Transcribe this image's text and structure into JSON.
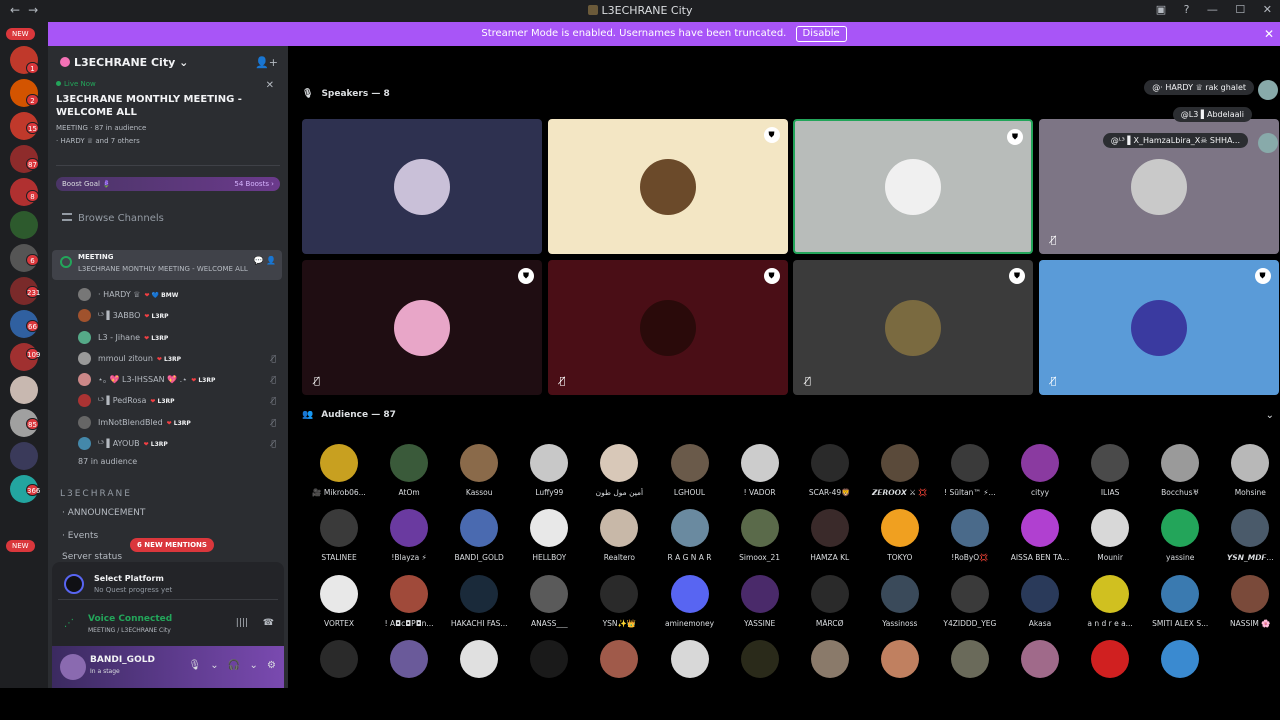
{
  "window": {
    "title": "L3ECHRANE City",
    "nav_back": "←",
    "nav_fwd": "→",
    "controls": "▣ ? — ☐ ✕"
  },
  "banner": {
    "text": "Streamer Mode is enabled. Usernames have been truncated.",
    "button": "Disable",
    "close": "✕"
  },
  "guilds": {
    "new_top": "NEW",
    "new_bottom": "NEW",
    "badges": [
      "1",
      "2",
      "15",
      "87",
      "8",
      "6",
      "231",
      "66",
      "109",
      "85",
      "366"
    ]
  },
  "server": {
    "name": "L3ECHRANE City",
    "chevron": "⌄",
    "invite_icon": "👤+"
  },
  "live": {
    "label": "Live Now",
    "title": "L3ECHRANE MONTHLY MEETING - WELCOME ALL",
    "meta_label": "MEETING",
    "audience": "87 in audience",
    "host": "· HARDY ♕ and 7 others",
    "close": "✕"
  },
  "boost": {
    "label": "Boost Goal 🪻",
    "count": "54 Boosts ›"
  },
  "browse": "Browse Channels",
  "meeting": {
    "name": "MEETING",
    "sub": "L3ECHRANE MONTHLY MEETING - WELCOME ALL",
    "icons": "💬 👤"
  },
  "members": [
    {
      "name": "· HARDY ♕",
      "tag": "💙 BMW",
      "color": "#777",
      "muted": false
    },
    {
      "name": "ᴸ³ ▌3ABBO",
      "tag": "L3RP",
      "color": "#a0522d",
      "muted": false
    },
    {
      "name": "L3 - Jihane",
      "tag": "L3RP",
      "color": "#5a8",
      "muted": false
    },
    {
      "name": "mmoul zitoun",
      "tag": "L3RP",
      "color": "#999",
      "muted": true
    },
    {
      "name": "⋆｡ 💖 L3-IHSSAN 💖 .⋆",
      "tag": "L3RP",
      "color": "#c88",
      "muted": true
    },
    {
      "name": "ᴸ³ ▌PedRosa",
      "tag": "L3RP",
      "color": "#a33",
      "muted": true
    },
    {
      "name": "ImNotBlendBled",
      "tag": "L3RP",
      "color": "#666",
      "muted": true
    },
    {
      "name": "ᴸ³ ▌AYOUB",
      "tag": "L3RP",
      "color": "#48a",
      "muted": true
    }
  ],
  "member_tag_heart": "❤",
  "audience_line": "87 in audience",
  "category": "L3ECHRANE",
  "channels": [
    {
      "name": "· ANNOUNCEMENT"
    },
    {
      "name": "· Events"
    },
    {
      "name": "Server status"
    }
  ],
  "mentions": "6 NEW MENTIONS",
  "quest": {
    "title": "Select Platform",
    "sub": "No Quest progress yet"
  },
  "voice": {
    "status": "Voice Connected",
    "channel": "MEETING / L3ECHRANE City",
    "icons": "|||| ☎"
  },
  "user": {
    "name": "BANDI_GOLD",
    "status": "In a stage",
    "controls": "🎙 ⌄ 🎧 ⌄ ⚙"
  },
  "speakers": {
    "label": "Speakers — 8",
    "icon": "🎙"
  },
  "speaker_tiles": [
    {
      "bg": "#2e3150",
      "av": "#c9c0d8",
      "mod": false,
      "mic_off": false
    },
    {
      "bg": "#f3e6c4",
      "av": "#6b4a2a",
      "mod": true,
      "mic_off": false
    },
    {
      "bg": "#b8bcba",
      "av": "#f0f0f0",
      "mod": true,
      "mic_off": false
    },
    {
      "bg": "#7d7585",
      "av": "#c9c9c9",
      "mod": false,
      "mic_off": true
    },
    {
      "bg": "#1f0d12",
      "av": "#e8a6c8",
      "mod": true,
      "mic_off": true
    },
    {
      "bg": "#4a0e16",
      "av": "#2a0a0a",
      "mod": true,
      "mic_off": true
    },
    {
      "bg": "#3b3b3b",
      "av": "#7a6a40",
      "mod": true,
      "mic_off": true
    },
    {
      "bg": "#5a9bd8",
      "av": "#3a3aa0",
      "mod": true,
      "mic_off": true
    }
  ],
  "floating": [
    {
      "text": "@· HARDY ♕ rak ghalet"
    },
    {
      "text": "@L3 ▌Abdelaali"
    },
    {
      "text": "@ᴸ³ ▌X_HamzaLbira_X☠ SHHA..."
    }
  ],
  "audience": {
    "label": "Audience — 87",
    "icon": "👥",
    "chevron": "⌄"
  },
  "audience_rows": [
    [
      {
        "name": "🎥 Mikrob06...",
        "c": "#c8a020"
      },
      {
        "name": "AtOm",
        "c": "#3a5a3a"
      },
      {
        "name": "Kassou",
        "c": "#8a6a4a"
      },
      {
        "name": "Luffy99",
        "c": "#c8c8c8"
      },
      {
        "name": "أمين مول طون",
        "c": "#d8c8b8"
      },
      {
        "name": "LGHOUL",
        "c": "#6a5a4a"
      },
      {
        "name": "! VADOR",
        "c": "#cccccc"
      },
      {
        "name": "SCAR-49🦁",
        "c": "#2a2a2a"
      },
      {
        "name": "𝙕𝙀𝙍𝙊𝙊𝙓 ⚔ 💢",
        "c": "#5a4a3a"
      },
      {
        "name": "! Sũltan™ ⚡...",
        "c": "#3a3a3a"
      },
      {
        "name": "cityy",
        "c": "#8a3aa0"
      },
      {
        "name": "ILIAS",
        "c": "#4a4a4a"
      },
      {
        "name": "Bocchus♅",
        "c": "#9a9a9a"
      },
      {
        "name": "Mohsine",
        "c": "#b8b8b8"
      }
    ],
    [
      {
        "name": "STALINEE",
        "c": "#3a3a3a"
      },
      {
        "name": "!Blayza ⚡",
        "c": "#6a3aa0"
      },
      {
        "name": "BANDI_GOLD",
        "c": "#4a6ab0"
      },
      {
        "name": "HELLBOY",
        "c": "#e8e8e8"
      },
      {
        "name": "Realtero",
        "c": "#c8b8a8"
      },
      {
        "name": "R A G N A R",
        "c": "#6a8aa0"
      },
      {
        "name": "Simoox_21",
        "c": "#5a6a4a"
      },
      {
        "name": "HAMZA KL",
        "c": "#3a2a2a"
      },
      {
        "name": "TOKYO",
        "c": "#f0a020"
      },
      {
        "name": "!RoByO💢",
        "c": "#4a6a8a"
      },
      {
        "name": "AISSA BEN TA...",
        "c": "#b040d0"
      },
      {
        "name": "Mounir",
        "c": "#d8d8d8"
      },
      {
        "name": "yassine",
        "c": "#23a55a"
      },
      {
        "name": "𝙔𝙎𝙉_𝙈𝘿𝙁...",
        "c": "#4a5a6a"
      }
    ],
    [
      {
        "name": "VORTEX",
        "c": "#e8e8e8"
      },
      {
        "name": "! A◘c◘P◘n...",
        "c": "#a04a3a"
      },
      {
        "name": "HAKACHI FAS...",
        "c": "#1a2a3a"
      },
      {
        "name": "ANASS___",
        "c": "#5a5a5a"
      },
      {
        "name": "YSN✨👑",
        "c": "#2a2a2a"
      },
      {
        "name": "aminemoney",
        "c": "#5865f2"
      },
      {
        "name": "YASSINE",
        "c": "#4a2a6a"
      },
      {
        "name": "MÃRCØ",
        "c": "#2a2a2a"
      },
      {
        "name": "Yassinoss",
        "c": "#3a4a5a"
      },
      {
        "name": "Y4ZIDDD_YEG",
        "c": "#3a3a3a"
      },
      {
        "name": "Akasa",
        "c": "#2a3a5a"
      },
      {
        "name": "a n d r e a...",
        "c": "#d0c020"
      },
      {
        "name": "SMITI ALEX S...",
        "c": "#3a7ab0"
      },
      {
        "name": "NASSIM 🌸",
        "c": "#7a4a3a"
      }
    ],
    [
      {
        "name": "",
        "c": "#2a2a2a"
      },
      {
        "name": "",
        "c": "#6a5a9a"
      },
      {
        "name": "",
        "c": "#e0e0e0"
      },
      {
        "name": "",
        "c": "#1a1a1a"
      },
      {
        "name": "",
        "c": "#a05a4a"
      },
      {
        "name": "",
        "c": "#d8d8d8"
      },
      {
        "name": "",
        "c": "#2a2a1a"
      },
      {
        "name": "",
        "c": "#8a7a6a"
      },
      {
        "name": "",
        "c": "#c08060"
      },
      {
        "name": "",
        "c": "#6a6a5a"
      },
      {
        "name": "",
        "c": "#a06a8a"
      },
      {
        "name": "",
        "c": "#d02020"
      },
      {
        "name": "",
        "c": "#3a8ad0"
      },
      {
        "name": "",
        "c": "#000000"
      }
    ]
  ]
}
